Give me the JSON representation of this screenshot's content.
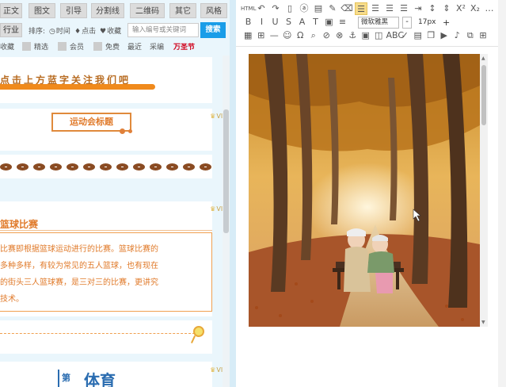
{
  "left": {
    "tabs": [
      "正文",
      "图文",
      "引导",
      "分割线",
      "二维码",
      "其它",
      "风格"
    ],
    "industry_label": "行业",
    "sort_label": "排序:",
    "sort_options": [
      {
        "icon": "clock-icon",
        "glyph": "◷",
        "label": "时间"
      },
      {
        "icon": "thumb-icon",
        "glyph": "♦",
        "label": "点击"
      },
      {
        "icon": "heart-icon",
        "glyph": "♥",
        "label": "收藏"
      }
    ],
    "search_placeholder": "输入编号或关键词",
    "search_button": "搜索",
    "categories": [
      "收藏",
      "精选",
      "会员",
      "免费",
      "最近",
      "采编",
      "万圣节"
    ],
    "vip_label": "VIP",
    "banner_text": "点击上方蓝字关注我们吧",
    "title_card_label": "运动会标题",
    "football_count": 13,
    "basketball_title": "篮球比赛",
    "basketball_lines": [
      "比赛即根据篮球运动进行的比赛。篮球比赛的",
      "多种多样，有较为常见的五人篮球，也有现在",
      "的街头三人篮球赛，是三对三的比赛，更讲究",
      "技术。"
    ],
    "sport_number": "第",
    "sport_title": "体育"
  },
  "editor": {
    "toolbar_row1": [
      {
        "name": "html-icon",
        "glyph": "HTML",
        "small": true
      },
      {
        "name": "undo-icon",
        "glyph": "↶"
      },
      {
        "name": "redo-icon",
        "glyph": "↷"
      },
      {
        "name": "new-doc-icon",
        "glyph": "▯"
      },
      {
        "name": "copy-format-icon",
        "glyph": "ⓐ"
      },
      {
        "name": "clipboard-icon",
        "glyph": "▤"
      },
      {
        "name": "format-brush-icon",
        "glyph": "✎"
      },
      {
        "name": "clear-format-icon",
        "glyph": "⌫"
      },
      {
        "name": "align-left-icon",
        "glyph": "☰",
        "active": true
      },
      {
        "name": "align-center-icon",
        "glyph": "☰"
      },
      {
        "name": "align-right-icon",
        "glyph": "☰"
      },
      {
        "name": "align-justify-icon",
        "glyph": "☰"
      },
      {
        "name": "indent-icon",
        "glyph": "⇥"
      },
      {
        "name": "line-height-icon",
        "glyph": "↕"
      },
      {
        "name": "para-spacing-icon",
        "glyph": "⇕"
      },
      {
        "name": "superscript-icon",
        "glyph": "X²"
      },
      {
        "name": "subscript-icon",
        "glyph": "X₂"
      },
      {
        "name": "more-icon",
        "glyph": "…"
      }
    ],
    "toolbar_row2": [
      {
        "name": "bold-icon",
        "glyph": "B"
      },
      {
        "name": "italic-icon",
        "glyph": "I"
      },
      {
        "name": "underline-icon",
        "glyph": "U"
      },
      {
        "name": "strikethrough-icon",
        "glyph": "S"
      },
      {
        "name": "font-color-icon",
        "glyph": "A"
      },
      {
        "name": "background-color-icon",
        "glyph": "T"
      },
      {
        "name": "image-icon",
        "glyph": "▣"
      },
      {
        "name": "list-icon",
        "glyph": "≡"
      }
    ],
    "font_family": "微软雅黑",
    "font_size": "17px",
    "size_minus": "-",
    "size_plus": "+",
    "toolbar_row3": [
      {
        "name": "table-icon",
        "glyph": "▦"
      },
      {
        "name": "table-edit-icon",
        "glyph": "⊞"
      },
      {
        "name": "hr-icon",
        "glyph": "—"
      },
      {
        "name": "emotion-icon",
        "glyph": "☺"
      },
      {
        "name": "special-char-icon",
        "glyph": "Ω"
      },
      {
        "name": "search-replace-icon",
        "glyph": "⌕"
      },
      {
        "name": "link-icon",
        "glyph": "⊘"
      },
      {
        "name": "unlink-icon",
        "glyph": "⊗"
      },
      {
        "name": "anchor-icon",
        "glyph": "⚓"
      },
      {
        "name": "insert-image-icon",
        "glyph": "▣"
      },
      {
        "name": "map-icon",
        "glyph": "◫"
      },
      {
        "name": "case-icon",
        "glyph": "ABC"
      },
      {
        "name": "spellcheck-icon",
        "glyph": "✓"
      },
      {
        "name": "preview-icon",
        "glyph": "▤"
      },
      {
        "name": "template-icon",
        "glyph": "❐"
      },
      {
        "name": "video-icon",
        "glyph": "▶"
      },
      {
        "name": "music-icon",
        "glyph": "♪"
      },
      {
        "name": "attachment-icon",
        "glyph": "⧉"
      }
    ],
    "toolbar_row4": [
      {
        "name": "grid-icon",
        "glyph": "⊞"
      }
    ]
  }
}
